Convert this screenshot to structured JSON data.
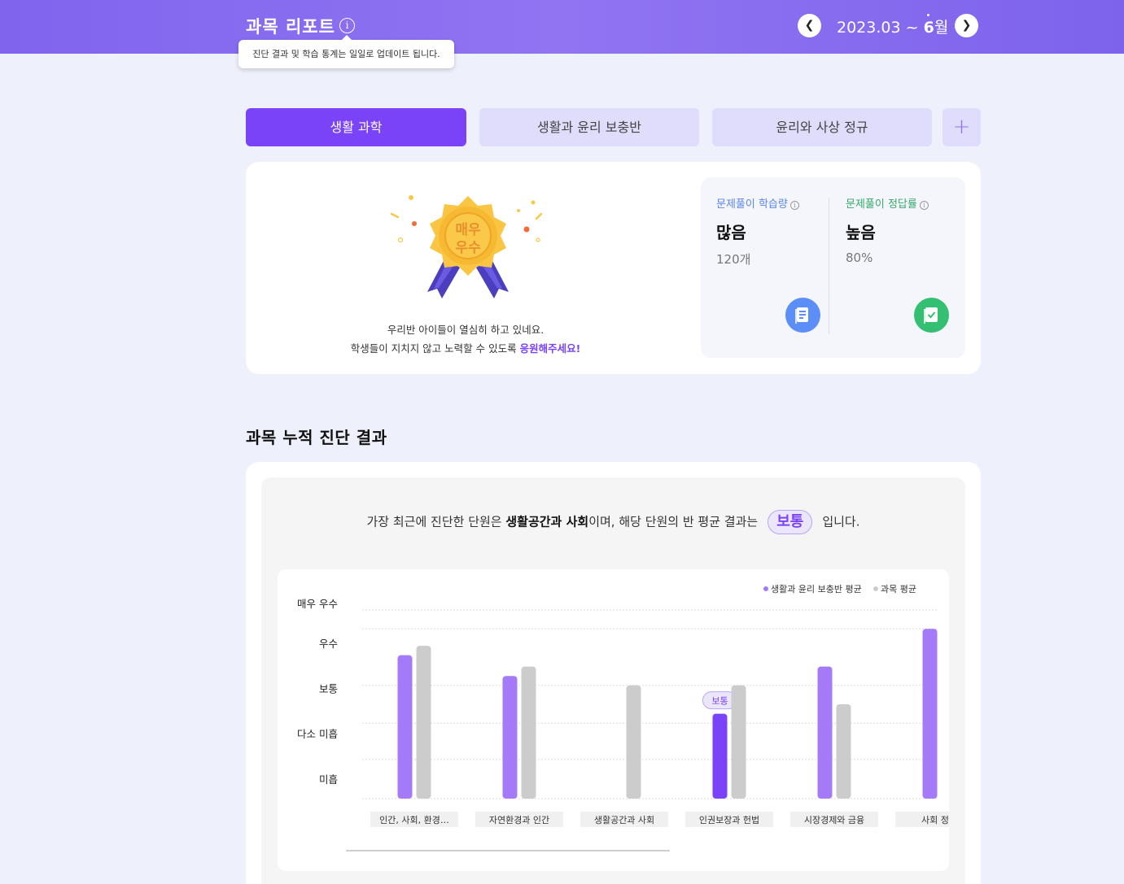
{
  "header": {
    "title": "과목 리포트",
    "info_icon": "info-icon",
    "tooltip": "진단 결과 및 학습 통계는 일일로 업데이트 됩니다.",
    "date_prefix": "2023.03 ~ ",
    "date_month": "6",
    "date_suffix": "월",
    "prev_icon": "chevron-left-icon",
    "next_icon": "chevron-right-icon"
  },
  "tabs": [
    {
      "label": "생활 과학",
      "active": true
    },
    {
      "label": "생활과 윤리 보충반",
      "active": false
    },
    {
      "label": "윤리와 사상 정규",
      "active": false
    }
  ],
  "add_tab_label": "+",
  "summary": {
    "medal_text_1": "매우",
    "medal_text_2": "우수",
    "cheer_line_1": "우리반 아이들이 열심히 하고 있네요.",
    "cheer_line_2_prefix": "학생들이 지치지 않고 노력할 수 있도록 ",
    "cheer_line_2_highlight": "응원해주세요!",
    "stats": [
      {
        "label": "문제풀이 학습량",
        "value": "많음",
        "sub": "120개",
        "icon": "document-icon"
      },
      {
        "label": "문제풀이 정답률",
        "value": "높음",
        "sub": "80%",
        "icon": "check-note-icon"
      }
    ]
  },
  "section_title": "과목 누적 진단 결과",
  "result_summary": {
    "prefix": "가장 최근에 진단한 단원은 ",
    "unit": "생활공간과 사회",
    "middle": "이며, 해당 단원의 반 평균 결과는",
    "level": "보통",
    "suffix": "입니다."
  },
  "colors": {
    "accent": "#7b43f8",
    "class_bar": "#a47af8",
    "subject_bar": "#cccccc",
    "highlight_bar": "#7b43f8"
  },
  "chart_data": {
    "type": "bar",
    "categories": [
      "인간, 사회, 환경…",
      "자연환경과 인간",
      "생활공간과 사회",
      "인권보장과 헌법",
      "시장경제와 금융",
      "사회 정의"
    ],
    "y_levels": [
      "미흡",
      "다소 미흡",
      "보통",
      "우수",
      "매우 우수"
    ],
    "ylim": [
      0,
      5
    ],
    "series": [
      {
        "name": "생활과 윤리 보충반 평균",
        "values": [
          3.8,
          3.25,
          null,
          2.25,
          3.5,
          4.5
        ]
      },
      {
        "name": "과목 평균",
        "values": [
          4.05,
          3.5,
          3.0,
          3.0,
          2.5,
          null
        ]
      }
    ],
    "highlight": {
      "category_index": 3,
      "series_index": 0,
      "label": "보통"
    },
    "legend_position": "top-right",
    "grid": true
  }
}
